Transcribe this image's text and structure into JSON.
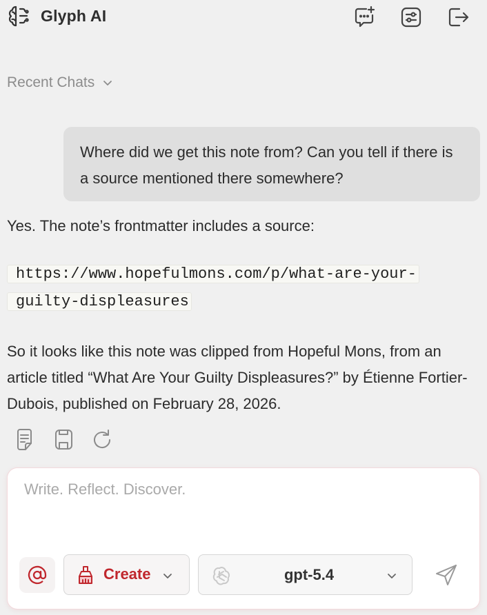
{
  "app": {
    "title": "Glyph AI",
    "icons": {
      "logo": "brain-icon",
      "new_chat": "new-chat-icon",
      "settings": "sliders-icon",
      "logout": "logout-icon"
    }
  },
  "sidebar": {
    "recent_label": "Recent Chats",
    "recent_icon": "chevron-down-icon"
  },
  "conversation": {
    "user_message": "Where did we get this note from? Can you tell if there is a source mentioned there somewhere?",
    "assistant": {
      "intro": "Yes. The note’s frontmatter includes a source:",
      "source_url": "https://www.hopefulmons.com/p/what-are-your-guilty-displeasures",
      "conclusion": "So it looks like this note was clipped from Hopeful Mons, from an article titled “What Are Your Guilty Displeasures?” by Étienne Fortier-Dubois, published on February 28, 2026."
    },
    "message_actions": [
      "note-icon",
      "save-icon",
      "regenerate-icon"
    ]
  },
  "composer": {
    "placeholder": "Write. Reflect. Discover.",
    "value": "",
    "mention_icon": "at-icon",
    "mode_label": "Create",
    "mode_icon": "brush-icon",
    "model_label": "gpt-5.4",
    "model_icon": "openai-icon",
    "send_icon": "send-icon"
  },
  "colors": {
    "background": "#f0f0f0",
    "accent": "#c0272d",
    "bubble": "#dfdfdf",
    "muted": "#8c8c8c"
  }
}
